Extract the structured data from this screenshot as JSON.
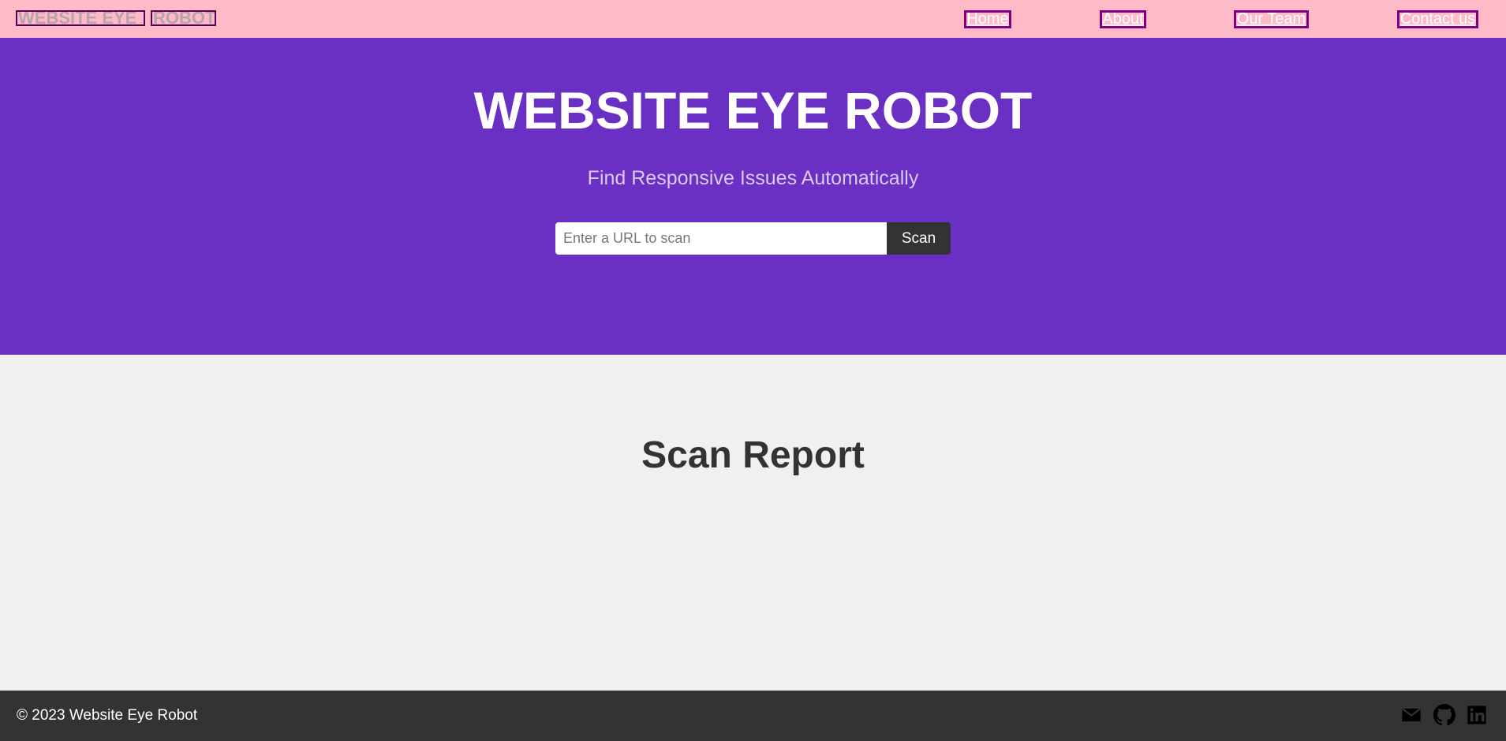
{
  "navbar": {
    "brand_part1": "WEBSITE EYE",
    "brand_part2": "ROBOT",
    "links": [
      {
        "label": "Home"
      },
      {
        "label": "About"
      },
      {
        "label": "Our Team"
      },
      {
        "label": "Contact us"
      }
    ],
    "background": "#ffbac8",
    "link_border_color": "#800080"
  },
  "hero": {
    "title": "WEBSITE EYE ROBOT",
    "subtitle": "Find Responsive Issues Automatically",
    "search": {
      "placeholder": "Enter a URL to scan",
      "value": "",
      "button_label": "Scan"
    },
    "background": "#6a2fc3"
  },
  "report": {
    "title": "Scan Report"
  },
  "footer": {
    "copyright": "© 2023 Website Eye Robot",
    "icons": [
      "email-icon",
      "github-icon",
      "linkedin-icon"
    ],
    "background": "#333333"
  }
}
